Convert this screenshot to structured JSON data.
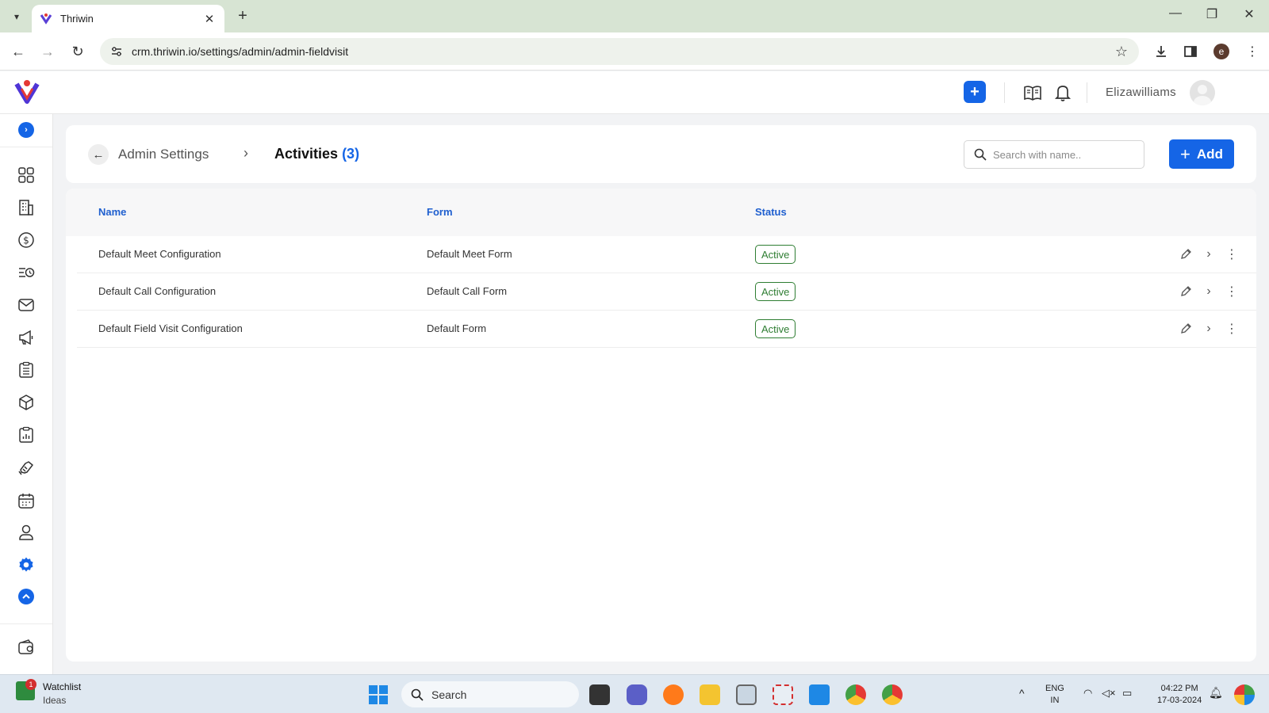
{
  "browser": {
    "tab_title": "Thriwin",
    "tab_close": "✕",
    "new_tab": "+",
    "url": "crm.thriwin.io/settings/admin/admin-fieldvisit",
    "profile_initial": "e"
  },
  "header": {
    "username": "Elizawilliams"
  },
  "breadcrumb": {
    "parent": "Admin Settings",
    "current": "Activities",
    "count": "(3)"
  },
  "search": {
    "placeholder": "Search with name.."
  },
  "add_button": {
    "label": "Add"
  },
  "table": {
    "columns": [
      "Name",
      "Form",
      "Status"
    ],
    "rows": [
      {
        "name": "Default Meet Configuration",
        "form": "Default Meet Form",
        "status": "Active"
      },
      {
        "name": "Default Call Configuration",
        "form": "Default Call Form",
        "status": "Active"
      },
      {
        "name": "Default Field Visit Configuration",
        "form": "Default Form",
        "status": "Active"
      }
    ]
  },
  "taskbar": {
    "widget_title": "Watchlist",
    "widget_sub": "Ideas",
    "widget_badge": "1",
    "search_label": "Search",
    "lang_line1": "ENG",
    "lang_line2": "IN",
    "time": "04:22 PM",
    "date": "17-03-2024"
  },
  "colors": {
    "primary": "#1565e6",
    "status_active": "#2e7d32",
    "tabbar": "#d7e4d3"
  }
}
